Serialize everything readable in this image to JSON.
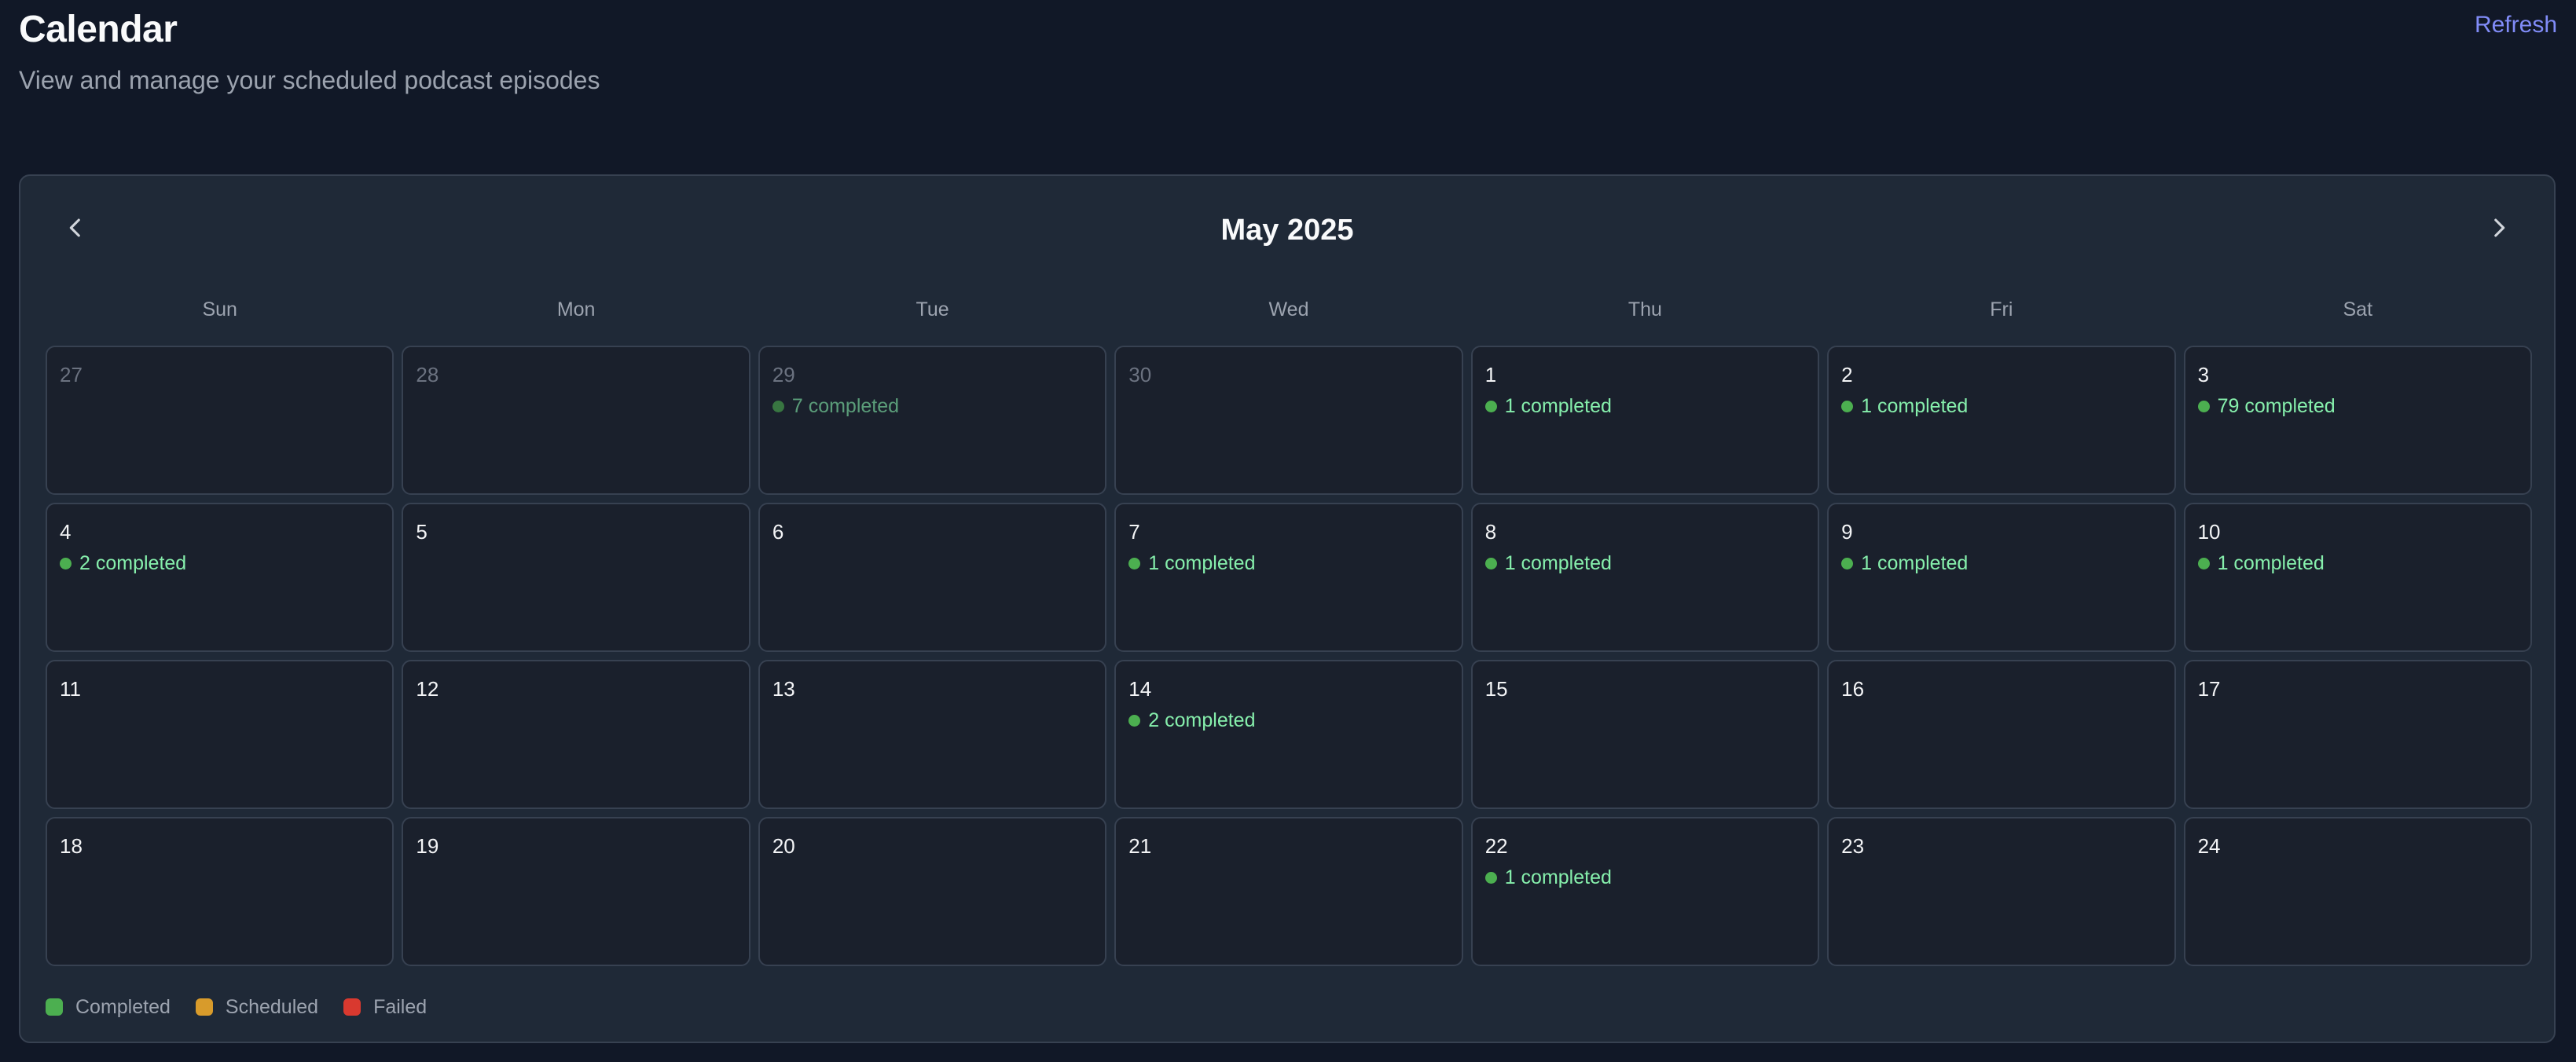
{
  "header": {
    "title": "Calendar",
    "subtitle": "View and manage your scheduled podcast episodes",
    "refresh_label": "Refresh"
  },
  "calendar": {
    "month_label": "May 2025",
    "prev_icon": "chevron-left-icon",
    "next_icon": "chevron-right-icon",
    "weekdays": [
      "Sun",
      "Mon",
      "Tue",
      "Wed",
      "Thu",
      "Fri",
      "Sat"
    ],
    "days": [
      {
        "day": "27",
        "outside": true,
        "event": null
      },
      {
        "day": "28",
        "outside": true,
        "event": null
      },
      {
        "day": "29",
        "outside": true,
        "event": "7 completed"
      },
      {
        "day": "30",
        "outside": true,
        "event": null
      },
      {
        "day": "1",
        "outside": false,
        "event": "1 completed"
      },
      {
        "day": "2",
        "outside": false,
        "event": "1 completed"
      },
      {
        "day": "3",
        "outside": false,
        "event": "79 completed"
      },
      {
        "day": "4",
        "outside": false,
        "event": "2 completed"
      },
      {
        "day": "5",
        "outside": false,
        "event": null
      },
      {
        "day": "6",
        "outside": false,
        "event": null
      },
      {
        "day": "7",
        "outside": false,
        "event": "1 completed"
      },
      {
        "day": "8",
        "outside": false,
        "event": "1 completed"
      },
      {
        "day": "9",
        "outside": false,
        "event": "1 completed"
      },
      {
        "day": "10",
        "outside": false,
        "event": "1 completed"
      },
      {
        "day": "11",
        "outside": false,
        "event": null
      },
      {
        "day": "12",
        "outside": false,
        "event": null
      },
      {
        "day": "13",
        "outside": false,
        "event": null
      },
      {
        "day": "14",
        "outside": false,
        "event": "2 completed"
      },
      {
        "day": "15",
        "outside": false,
        "event": null
      },
      {
        "day": "16",
        "outside": false,
        "event": null
      },
      {
        "day": "17",
        "outside": false,
        "event": null
      },
      {
        "day": "18",
        "outside": false,
        "event": null
      },
      {
        "day": "19",
        "outside": false,
        "event": null
      },
      {
        "day": "20",
        "outside": false,
        "event": null
      },
      {
        "day": "21",
        "outside": false,
        "event": null
      },
      {
        "day": "22",
        "outside": false,
        "event": "1 completed"
      },
      {
        "day": "23",
        "outside": false,
        "event": null
      },
      {
        "day": "24",
        "outside": false,
        "event": null
      }
    ]
  },
  "legend": [
    {
      "label": "Completed",
      "color": "#4caf50"
    },
    {
      "label": "Scheduled",
      "color": "#d89b2b"
    },
    {
      "label": "Failed",
      "color": "#d9392f"
    }
  ],
  "colors": {
    "accent": "#818cf8",
    "completed_text": "#86efac",
    "completed_dot": "#4caf50",
    "background": "#111827",
    "card": "#1f2937"
  }
}
